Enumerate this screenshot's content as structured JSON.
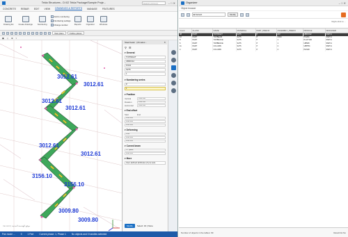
{
  "left_window": {
    "title": "Tekla Structures - D:\\02 Tekla Package\\Sample Proje...",
    "search_placeholder": "Search (Ctrl+Q)",
    "window_controls": "–  □  ✕",
    "menu": [
      "CONCRETE",
      "REBAR",
      "EDIT",
      "VIEW",
      "DRAWINGS & REPORTS",
      "MANAGE",
      "FEATURES"
    ],
    "menu_active_index": 4,
    "ribbon": {
      "drawing_list": "Drawing list",
      "create_drawings": "Create drawings",
      "numbering": "Numbering",
      "row_items": [
        "Add to numbering",
        "Numbering settings",
        "Change number"
      ],
      "reports": "Reports",
      "organizer": "Organizer",
      "windows": "Windows"
    },
    "toolbar_dropdowns": [
      "View plane",
      "Outline planes"
    ],
    "toolbar3_items": [
      "▣",
      "◇",
      "⊕",
      "▿"
    ],
    "viewport": {
      "dimension_labels": [
        "3012.61",
        "3012.61",
        "3012.61",
        "3012.61",
        "3012.61",
        "3012.61",
        "3156.10",
        "3156.10",
        "3009.80",
        "3009.80"
      ],
      "watermark": "mo.com | موقع الهندسة المدنية"
    },
    "properties": {
      "header": "Steel beam",
      "header_suffix": "(16 selec...",
      "header_icons": [
        "⚲",
        "☰"
      ],
      "close": "✕",
      "section_general": "General",
      "general_values": [
        "TOPNIGHT",
        "UBR/O12",
        "PUF4",
        "S275"
      ],
      "phase_value": "1",
      "section_numbering": "Numbering series",
      "numbering_values": [
        "P",
        "1"
      ],
      "section_position": "Position",
      "position_rows": [
        {
          "key": "Vertical",
          "value": "0.00 mm"
        },
        {
          "key": "Rotation",
          "value": "0.00 mm"
        },
        {
          "key": "Horizontal",
          "value": "0.00 mm"
        }
      ],
      "section_endoffset": "End offset",
      "endoffset_heads": [
        "Start",
        "End"
      ],
      "endoffset_rows": [
        "0.00 mm",
        "0.00 mm",
        "0.00 mm"
      ],
      "section_deforming": "Deforming",
      "deforming_rows": [
        "0.00",
        "0.00 mm",
        "0.00 mm"
      ],
      "section_curved": "Curved beam",
      "curved_value": "XY plane",
      "curved_value2": "0.00 mm",
      "section_more": "More",
      "more_hint": "User-defined attributes (0 pre sele",
      "modify_button": "Modify",
      "select_label": "Select: 16 | None"
    },
    "statusbar": [
      "Pan mode ...",
      "0",
      "1 Part",
      "Current phase: 1, Phase 1",
      "No objects and 0 handles selected"
    ]
  },
  "right_window": {
    "title": "Organizer",
    "window_controls": "–  □  ✕",
    "subtitle": "Object browser",
    "combo_value": "■ Default",
    "modify_button": "Modify",
    "hint": "Right-click to ...",
    "columns": [
      "Count",
      "CLASS",
      "NAME",
      "MATERIAL",
      "PART_PREFIX",
      "ASSEMBLY_PREFIX",
      "PROFILE",
      "DESIGNER"
    ],
    "rows": [
      [
        "98",
        "PART",
        "TOPNIGHT",
        "S275",
        "P",
        "AIV",
        "UBR/O12",
        "SMITH"
      ],
      [
        "10",
        "PART",
        "TOPBEAM",
        "S275",
        "P",
        "CWC",
        "PC204",
        "SMITH"
      ],
      [
        "8",
        "PART",
        "TOPBRACE",
        "S275",
        "P",
        "1",
        "PL10*100",
        "SMITH"
      ],
      [
        "6",
        "PART",
        "TOPBRACE",
        "S275",
        "P",
        "1",
        "UB508",
        "SMITH"
      ],
      [
        "11",
        "PART",
        "COLUMN",
        "S275",
        "P",
        "C",
        "UB8*84",
        "SMITH"
      ],
      [
        "4",
        "PART",
        "COLUMN",
        "S275",
        "P",
        "C",
        "PHS90",
        "SMITH"
      ]
    ],
    "status_left": "Number of objects in the tables: 99",
    "status_right": "Result list  No"
  }
}
